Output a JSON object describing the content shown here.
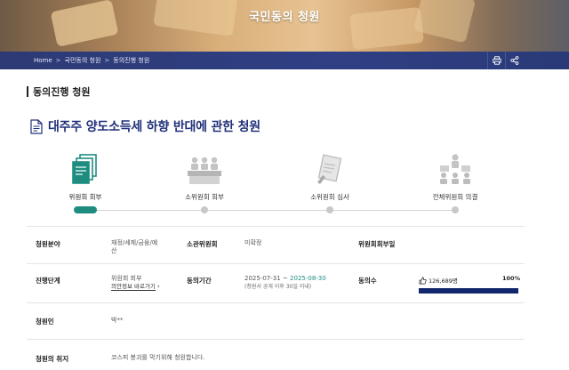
{
  "banner": {
    "title": "국민동의 청원"
  },
  "breadcrumb": [
    {
      "label": "Home"
    },
    {
      "label": "국민동의 청원"
    },
    {
      "label": "동의진행 청원"
    }
  ],
  "breadcrumb_separator": ">",
  "actions": [
    {
      "icon": "print-icon"
    },
    {
      "icon": "share-icon"
    }
  ],
  "section": {
    "title": "동의진행 청원"
  },
  "petition": {
    "title": "대주주 양도소득세 하향 반대에 관한 청원"
  },
  "steps": [
    {
      "label": "위원회 회부",
      "icon": "document-stack-icon",
      "active": true
    },
    {
      "label": "소위원회 회부",
      "icon": "meeting-table-icon",
      "active": false
    },
    {
      "label": "소위원회 심사",
      "icon": "review-pen-icon",
      "active": false
    },
    {
      "label": "전체위원회 의결",
      "icon": "committee-vote-icon",
      "active": false
    }
  ],
  "details": {
    "field_label": "청원분야",
    "field_value": "재정/세제/금융/예산",
    "committee_label": "소관위원회",
    "committee_value": "미확정",
    "subcommittee_label": "위원회회부일",
    "stage_label": "진행단계",
    "stage_value": "위원회 회부",
    "stage_link": "의안정보 바로가기",
    "period_label": "동의기간",
    "period_start": "2025-07-31",
    "period_separator": "~",
    "period_end": "2025-08-30",
    "period_note": "(청원서 공개 이후 30일 이내)",
    "agree_label": "동의수",
    "agree_count": "126,689명",
    "agree_percent": "100%",
    "agree_fraction": 1.0,
    "petitioner_label": "청원인",
    "petitioner_value": "박**",
    "purpose_label": "청원의 취지",
    "purpose_value": "코스피 붕괴를 막기위해 청원합니다."
  },
  "colors": {
    "accent": "#1e8d80",
    "navy": "#20307a",
    "bar": "#12266e"
  }
}
